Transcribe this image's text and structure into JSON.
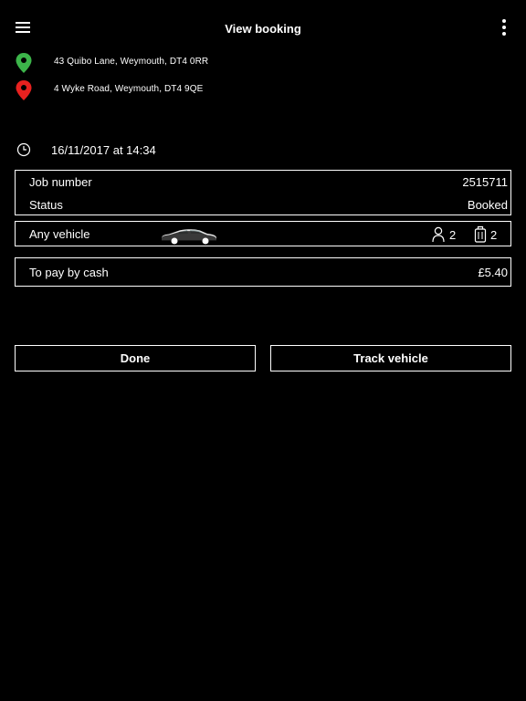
{
  "header": {
    "title": "View booking",
    "menu_icon": "hamburger-menu-icon",
    "more_icon": "more-vertical-icon"
  },
  "route": {
    "pickup": {
      "address": "43 Quibo Lane, Weymouth, DT4 0RR",
      "icon": "pin-icon",
      "color": "#3cb54a"
    },
    "dropoff": {
      "address": "4 Wyke Road, Weymouth, DT4 9QE",
      "icon": "pin-icon",
      "color": "#e8211f"
    }
  },
  "booking": {
    "datetime": "16/11/2017 at 14:34",
    "clock_icon": "clock-icon",
    "job_number_label": "Job number",
    "job_number": "2515711",
    "status_label": "Status",
    "status": "Booked"
  },
  "vehicle": {
    "type": "Any vehicle",
    "icon": "car-icon",
    "passengers": "2",
    "luggage": "2"
  },
  "payment": {
    "label": "To pay by cash",
    "amount": "£5.40"
  },
  "actions": {
    "done_label": "Done",
    "track_label": "Track vehicle"
  }
}
